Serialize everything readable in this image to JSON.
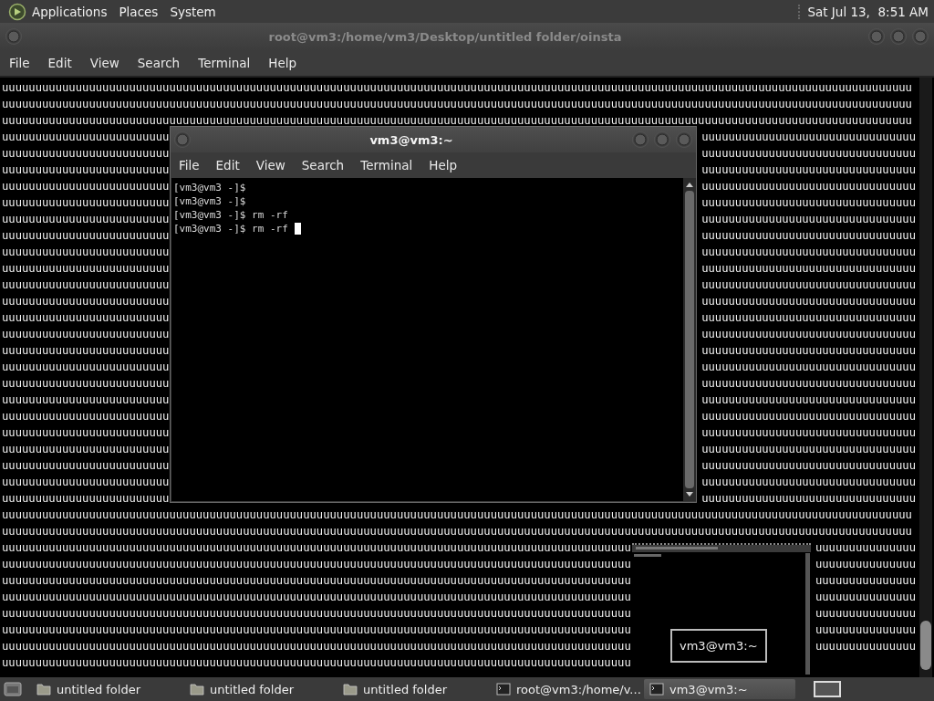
{
  "top_panel": {
    "menus": [
      "Applications",
      "Places",
      "System"
    ],
    "clock": "Sat Jul 13,  8:51 AM"
  },
  "main_window": {
    "title": "root@vm3:/home/vm3/Desktop/untitled folder/oinsta",
    "menu": [
      "File",
      "Edit",
      "View",
      "Search",
      "Terminal",
      "Help"
    ],
    "rows": [
      {
        "segments": [
          "uuuuuuuuuuuuuuuuuuuuuuuuuuuuuuuuuuuuuuuuuuuuuuuuuuuuuuuuuuuuuuuuuuuuuuuuuuuuuuuuuuuuuuuuuuuuuuuuuuuuuuuuuuuuuuuuuuuuuuuuuuuuuuuuuuuuuuuu"
        ]
      },
      {
        "segments": [
          "uuuuuuuuuuuuuuuuuuuuuuuuuuuuuuuuuuuuuuuuuuuuuuuuuuuuuuuuuuuuuuuuuuuuuuuuuuuuuuuuuuuuuuuuuuuuuuuuuuuuuuuuuuuuuuuuuuuuuuuuuuuuuuuuuuuuuuuu"
        ]
      },
      {
        "segments": [
          "uuuuuuuuuuuuuuuuuuuuuuuuuuuuuuuuuuuuuuuuuuuuuuuuuuuuuuuuuuuuuuuuuuuuuuuuuuuuuuuuuuuuuuuuuuuuuuuuuuuuuuuuuuuuuuuuuuuuuuuuuuuuuuuuuuuuuuuu"
        ]
      },
      {
        "segments": [
          "uuuuuuuuuuuuuuuuuuuuuuuuu",
          "uuuuuuuuuuuuuuuuuuuuuuuuuuuuuuuu"
        ]
      },
      {
        "segments": [
          "uuuuuuuuuuuuuuuuuuuuuuuuu",
          "uuuuuuuuuuuuuuuuuuuuuuuuuuuuuuuu"
        ]
      },
      {
        "segments": [
          "uuuuuuuuuuuuuuuuuuuuuuuuu",
          "uuuuuuuuuuuuuuuuuuuuuuuuuuuuuuuu"
        ]
      },
      {
        "segments": [
          "uuuuuuuuuuuuuuuuuuuuuuuuu",
          "uuuuuuuuuuuuuuuuuuuuuuuuuuuuuuuu"
        ]
      },
      {
        "segments": [
          "uuuuuuuuuuuuuuuuuuuuuuuuu",
          "uuuuuuuuuuuuuuuuuuuuuuuuuuuuuuuu"
        ]
      },
      {
        "segments": [
          "uuuuuuuuuuuuuuuuuuuuuuuuu",
          "uuuuuuuuuuuuuuuuuuuuuuuuuuuuuuuu"
        ]
      },
      {
        "segments": [
          "uuuuuuuuuuuuuuuuuuuuuuuuu",
          "uuuuuuuuuuuuuuuuuuuuuuuuuuuuuuuu"
        ]
      },
      {
        "segments": [
          "uuuuuuuuuuuuuuuuuuuuuuuuu",
          "uuuuuuuuuuuuuuuuuuuuuuuuuuuuuuuu"
        ]
      },
      {
        "segments": [
          "uuuuuuuuuuuuuuuuuuuuuuuuu",
          "uuuuuuuuuuuuuuuuuuuuuuuuuuuuuuuu"
        ]
      },
      {
        "segments": [
          "uuuuuuuuuuuuuuuuuuuuuuuuu",
          "uuuuuuuuuuuuuuuuuuuuuuuuuuuuuuuu"
        ]
      },
      {
        "segments": [
          "uuuuuuuuuuuuuuuuuuuuuuuuu",
          "uuuuuuuuuuuuuuuuuuuuuuuuuuuuuuuu"
        ]
      },
      {
        "segments": [
          "uuuuuuuuuuuuuuuuuuuuuuuuu",
          "uuuuuuuuuuuuuuuuuuuuuuuuuuuuuuuu"
        ]
      },
      {
        "segments": [
          "uuuuuuuuuuuuuuuuuuuuuuuuu",
          "uuuuuuuuuuuuuuuuuuuuuuuuuuuuuuuu"
        ]
      },
      {
        "segments": [
          "uuuuuuuuuuuuuuuuuuuuuuuuu",
          "uuuuuuuuuuuuuuuuuuuuuuuuuuuuuuuu"
        ]
      },
      {
        "segments": [
          "uuuuuuuuuuuuuuuuuuuuuuuuu",
          "uuuuuuuuuuuuuuuuuuuuuuuuuuuuuuuu"
        ]
      },
      {
        "segments": [
          "uuuuuuuuuuuuuuuuuuuuuuuuu",
          "uuuuuuuuuuuuuuuuuuuuuuuuuuuuuuuu"
        ]
      },
      {
        "segments": [
          "uuuuuuuuuuuuuuuuuuuuuuuuu",
          "uuuuuuuuuuuuuuuuuuuuuuuuuuuuuuuu"
        ]
      },
      {
        "segments": [
          "uuuuuuuuuuuuuuuuuuuuuuuuu",
          "uuuuuuuuuuuuuuuuuuuuuuuuuuuuuuuu"
        ]
      },
      {
        "segments": [
          "uuuuuuuuuuuuuuuuuuuuuuuuu",
          "uuuuuuuuuuuuuuuuuuuuuuuuuuuuuuuu"
        ]
      },
      {
        "segments": [
          "uuuuuuuuuuuuuuuuuuuuuuuuu",
          "uuuuuuuuuuuuuuuuuuuuuuuuuuuuuuuu"
        ]
      },
      {
        "segments": [
          "uuuuuuuuuuuuuuuuuuuuuuuuu",
          "uuuuuuuuuuuuuuuuuuuuuuuuuuuuuuuu"
        ]
      },
      {
        "segments": [
          "uuuuuuuuuuuuuuuuuuuuuuuuu",
          "uuuuuuuuuuuuuuuuuuuuuuuuuuuuuuuu"
        ]
      },
      {
        "segments": [
          "uuuuuuuuuuuuuuuuuuuuuuuuu",
          "uuuuuuuuuuuuuuuuuuuuuuuuuuuuuuuu"
        ]
      },
      {
        "segments": [
          "uuuuuuuuuuuuuuuuuuuuuuuuuuuuuuuuuuuuuuuuuuuuuuuuuuuuuuuuuuuuuuuuuuuuuuuuuuuuuuuuuuuuuuuuuuuuuuuuuuuuuuuuuuuuuuuuuuuuuuuuuuuuuuuuuuuuuuuu"
        ]
      },
      {
        "segments": [
          "uuuuuuuuuuuuuuuuuuuuuuuuuuuuuuuuuuuuuuuuuuuuuuuuuuuuuuuuuuuuuuuuuuuuuuuuuuuuuuuuuuuuuuuuuuuuuuuuuuuuuuuuuuuuuuuuuuuuuuuuuuuuuuuuuuuuuuuu"
        ]
      },
      {
        "segments": [
          "uuuuuuuuuuuuuuuuuuuuuuuuuuuuuuuuuuuuuuuuuuuuuuuuuuuuuuuuuuuuuuuuuuuuuuuuuuuuuuuuuuuuuuuuuuuuuu",
          "uuuuuuuuuuuuuuu"
        ]
      },
      {
        "segments": [
          "uuuuuuuuuuuuuuuuuuuuuuuuuuuuuuuuuuuuuuuuuuuuuuuuuuuuuuuuuuuuuuuuuuuuuuuuuuuuuuuuuuuuuuuuuuuuuu",
          "uuuuuuuuuuuuuuu"
        ]
      },
      {
        "segments": [
          "uuuuuuuuuuuuuuuuuuuuuuuuuuuuuuuuuuuuuuuuuuuuuuuuuuuuuuuuuuuuuuuuuuuuuuuuuuuuuuuuuuuuuuuuuuuuuu",
          "uuuuuuuuuuuuuuu"
        ]
      },
      {
        "segments": [
          "uuuuuuuuuuuuuuuuuuuuuuuuuuuuuuuuuuuuuuuuuuuuuuuuuuuuuuuuuuuuuuuuuuuuuuuuuuuuuuuuuuuuuuuuuuuuuu",
          "uuuuuuuuuuuuuuu"
        ]
      },
      {
        "segments": [
          "uuuuuuuuuuuuuuuuuuuuuuuuuuuuuuuuuuuuuuuuuuuuuuuuuuuuuuuuuuuuuuuuuuuuuuuuuuuuuuuuuuuuuuuuuuuuuu",
          "uuuuuuuuuuuuuuu"
        ]
      },
      {
        "segments": [
          "uuuuuuuuuuuuuuuuuuuuuuuuuuuuuuuuuuuuuuuuuuuuuuuuuuuuuuuuuuuuuuuuuuuuuuuuuuuuuuuuuuuuuuuuuuuuuu",
          "uuuuuuuuuuuuuuu"
        ]
      },
      {
        "segments": [
          "uuuuuuuuuuuuuuuuuuuuuuuuuuuuuuuuuuuuuuuuuuuuuuuuuuuuuuuuuuuuuuuuuuuuuuuuuuuuuuuuuuuuuuuuuuuuuu",
          "uuuuuuuuuuuuuuu"
        ]
      },
      {
        "segments": [
          "uuuuuuuuuuuuuuuuuuuuuuuuuuuuuuuuuuuuuuuuuuuuuuuuuuuuuuuuuuuuuuuuuuuuuuuuuuuuuuuuuuuuuuuuuuuuuu"
        ]
      }
    ]
  },
  "terminal_window": {
    "title": "vm3@vm3:~",
    "menu": [
      "File",
      "Edit",
      "View",
      "Search",
      "Terminal",
      "Help"
    ],
    "lines": [
      {
        "text": "[vm3@vm3 -]$",
        "cursor": false
      },
      {
        "text": "[vm3@vm3 -]$",
        "cursor": false
      },
      {
        "text": "[vm3@vm3 -]$ rm -rf",
        "cursor": false
      },
      {
        "text": "[vm3@vm3 -]$ rm -rf",
        "cursor": true
      }
    ]
  },
  "window_preview": {
    "kind": "picture",
    "tooltip": "vm3@vm3:~"
  },
  "taskbar": {
    "tasks": [
      {
        "kind": "folder",
        "label": "untitled folder",
        "selected": false
      },
      {
        "kind": "folder",
        "label": "untitled folder",
        "selected": false
      },
      {
        "kind": "folder",
        "label": "untitled folder",
        "selected": false
      },
      {
        "kind": "terminal",
        "label": "root@vm3:/home/v...",
        "selected": false
      },
      {
        "kind": "terminal",
        "label": "vm3@vm3:~",
        "selected": true
      }
    ]
  }
}
